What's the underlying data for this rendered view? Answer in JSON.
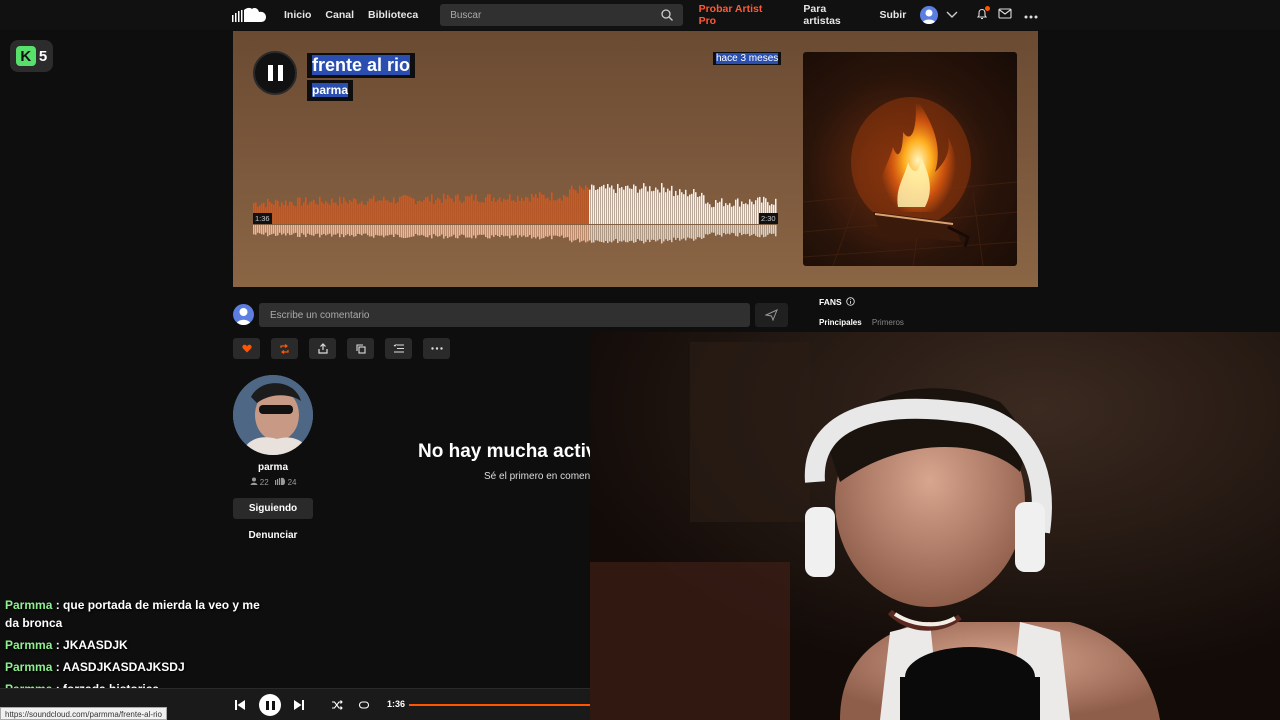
{
  "nav": {
    "links": [
      "Inicio",
      "Canal",
      "Biblioteca"
    ],
    "search_placeholder": "Buscar",
    "pro": "Probar Artist Pro",
    "for_artists": "Para artistas",
    "upload": "Subir"
  },
  "badge": {
    "letter": "K",
    "number": "5"
  },
  "track": {
    "title": "frente al rio",
    "artist": "parma",
    "posted": "hace 3 meses",
    "elapsed": "1:36",
    "duration": "2:30",
    "progress": 0.64
  },
  "comment": {
    "placeholder": "Escribe un comentario"
  },
  "fans": {
    "heading": "FANS",
    "tab_top": "Principales",
    "tab_first": "Primeros"
  },
  "uploader": {
    "name": "parma",
    "followers": "22",
    "tracks": "24",
    "follow_label": "Siguiendo",
    "report_label": "Denunciar"
  },
  "empty": {
    "title": "No hay mucha activ",
    "subtitle": "Sé el primero en coment"
  },
  "chat": [
    {
      "user": "Parmma",
      "text": " : que portada de mierda la veo y me da bronca"
    },
    {
      "user": "Parmma",
      "text": " : JKAASDJK"
    },
    {
      "user": "Parmma",
      "text": " : AASDJKASDAJKSDJ"
    },
    {
      "user": "Parmma",
      "text": " : forzada historica"
    }
  ],
  "player": {
    "time": "1:36",
    "progress": 0.0
  },
  "status_url": "https://soundcloud.com/parmma/frente-al-rio",
  "colors": {
    "accent": "#ff5500",
    "pro": "#ff5a36",
    "chat_user": "#8ef08e"
  }
}
